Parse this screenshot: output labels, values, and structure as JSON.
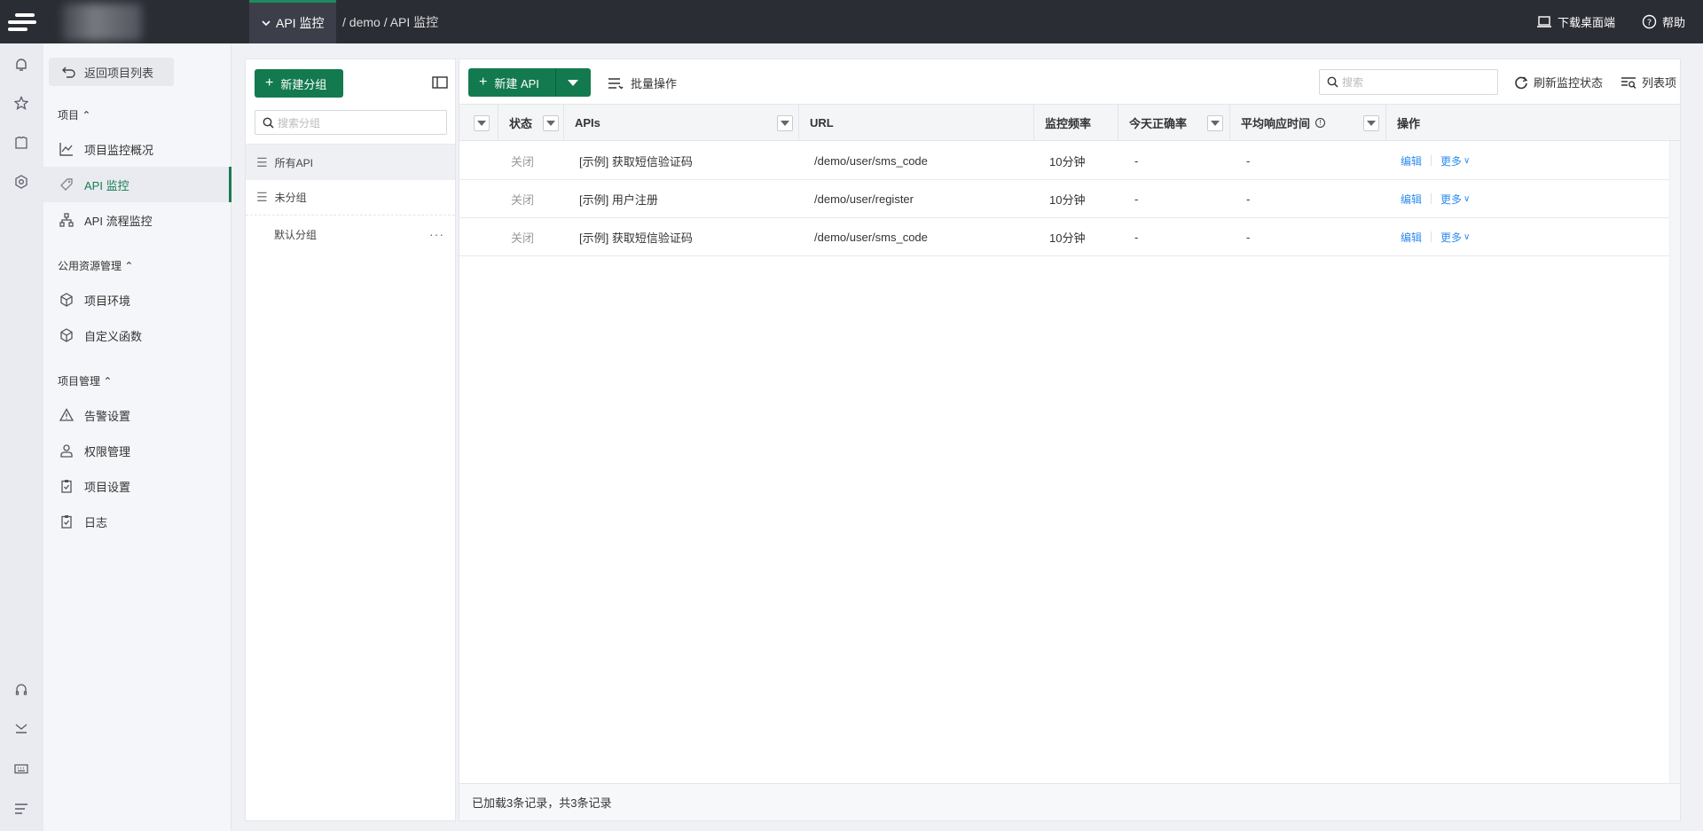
{
  "topbar": {
    "current_module": "API 监控",
    "breadcrumb": "/ demo / API 监控",
    "download_label": "下载桌面端",
    "help_label": "帮助"
  },
  "sidebar": {
    "back_label": "返回项目列表",
    "section_project": "项目",
    "section_public": "公用资源管理",
    "section_manage": "项目管理",
    "items": [
      {
        "label": "项目监控概况",
        "icon": "chart-line-icon"
      },
      {
        "label": "API 监控",
        "icon": "api-tag-icon"
      },
      {
        "label": "API 流程监控",
        "icon": "flow-tree-icon"
      },
      {
        "label": "项目环境",
        "icon": "cube-icon"
      },
      {
        "label": "自定义函数",
        "icon": "cube-icon"
      },
      {
        "label": "告警设置",
        "icon": "warning-icon"
      },
      {
        "label": "权限管理",
        "icon": "user-icon"
      },
      {
        "label": "项目设置",
        "icon": "clipboard-icon"
      },
      {
        "label": "日志",
        "icon": "log-icon"
      }
    ]
  },
  "groups": {
    "new_group_label": "新建分组",
    "search_placeholder": "搜索分组",
    "items": [
      {
        "label": "所有API"
      },
      {
        "label": "未分组"
      },
      {
        "label": "默认分组"
      }
    ]
  },
  "main": {
    "new_api_label": "新建 API",
    "batch_label": "批量操作",
    "search_placeholder": "搜索",
    "refresh_label": "刷新监控状态",
    "columns_label": "列表项",
    "headers": {
      "status": "状态",
      "apis": "APIs",
      "url": "URL",
      "freq": "监控频率",
      "today_rate": "今天正确率",
      "avg_time": "平均响应时间",
      "ops": "操作"
    },
    "rows": [
      {
        "status": "关闭",
        "api": "[示例] 获取短信验证码",
        "url": "/demo/user/sms_code",
        "freq": "10分钟",
        "rate": "-",
        "avg": "-",
        "edit": "编辑",
        "more": "更多"
      },
      {
        "status": "关闭",
        "api": "[示例] 用户注册",
        "url": "/demo/user/register",
        "freq": "10分钟",
        "rate": "-",
        "avg": "-",
        "edit": "编辑",
        "more": "更多"
      },
      {
        "status": "关闭",
        "api": "[示例] 获取短信验证码",
        "url": "/demo/user/sms_code",
        "freq": "10分钟",
        "rate": "-",
        "avg": "-",
        "edit": "编辑",
        "more": "更多"
      }
    ],
    "footer": "已加载3条记录，共3条记录"
  },
  "colors": {
    "accent": "#137a4f",
    "topbar": "#2b2d35",
    "link": "#2d8cf0"
  }
}
